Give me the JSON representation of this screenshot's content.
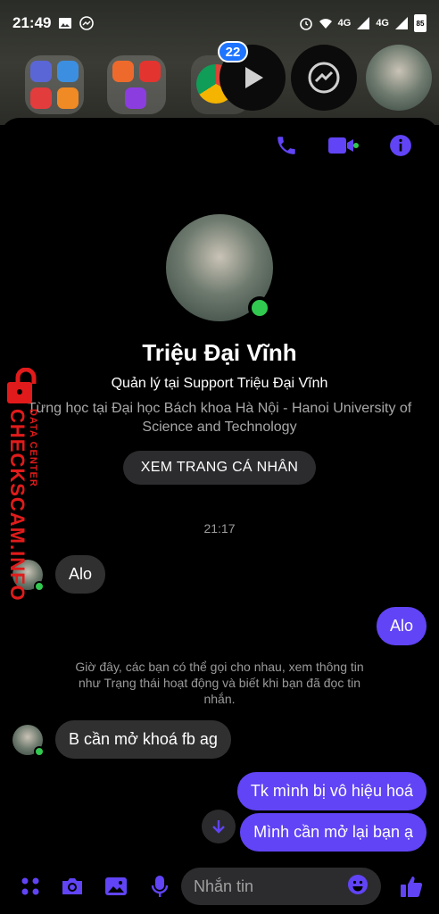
{
  "status_bar": {
    "time": "21:49",
    "network_1": "4G",
    "network_2": "4G",
    "battery": "85"
  },
  "home": {
    "notification_badge": "22"
  },
  "header": {
    "accent_color": "#6044f5",
    "icons": [
      "phone-icon",
      "video-icon",
      "info-icon"
    ]
  },
  "profile": {
    "name": "Triệu Đại Vĩnh",
    "work": "Quản lý tại Support Triệu Đại Vĩnh",
    "education": "Từng học tại Đại học Bách khoa Hà Nội - Hanoi University of Science and Technology",
    "view_profile_label": "XEM TRANG CÁ NHÂN"
  },
  "conversation": {
    "timestamp": "21:17",
    "notice": "Giờ đây, các bạn có thể gọi cho nhau, xem thông tin như Trạng thái hoạt động và biết khi bạn đã đọc tin nhắn.",
    "messages": [
      {
        "from": "them",
        "text": "Alo"
      },
      {
        "from": "me",
        "text": "Alo"
      },
      {
        "from": "them",
        "text": "B cần mở khoá fb ag"
      },
      {
        "from": "me",
        "text": "Tk mình bị vô hiệu hoá"
      },
      {
        "from": "me",
        "text": "Mình cần mở lại bạn ạ"
      }
    ]
  },
  "composer": {
    "placeholder": "Nhắn tin"
  },
  "watermark": {
    "top": "DATA CENTER",
    "main": "CHECKSCAM.INFO"
  }
}
